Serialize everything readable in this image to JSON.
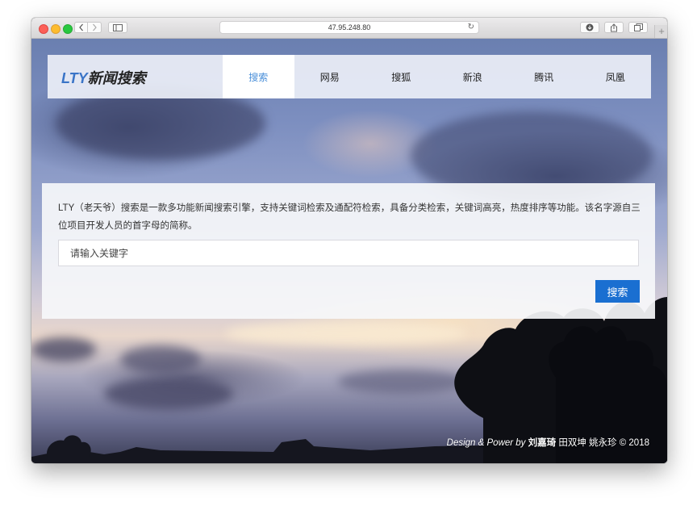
{
  "browser": {
    "url": "47.95.248.80",
    "icons": {
      "back": "chevron-left-icon",
      "forward": "chevron-right-icon",
      "sidebar": "sidebar-icon",
      "reload": "reload-icon",
      "download": "download-icon",
      "share": "share-icon",
      "tabs": "tabs-icon",
      "new_tab": "plus-icon"
    }
  },
  "header": {
    "logo_en": "LTY",
    "logo_cn": "新闻搜索",
    "nav": [
      {
        "label": "搜索",
        "active": true
      },
      {
        "label": "网易",
        "active": false
      },
      {
        "label": "搜狐",
        "active": false
      },
      {
        "label": "新浪",
        "active": false
      },
      {
        "label": "腾讯",
        "active": false
      },
      {
        "label": "凤凰",
        "active": false
      }
    ]
  },
  "search": {
    "description": "LTY（老天爷）搜索是一款多功能新闻搜索引擎，支持关键词检索及通配符检索，具备分类检索，关键词高亮，热度排序等功能。该名字源自三位项目开发人员的首字母的简称。",
    "placeholder": "请输入关键字",
    "value": "",
    "button_label": "搜索"
  },
  "footer": {
    "design_text": "Design & Power by",
    "author_1": "刘嘉琦",
    "others": "田双坤 姚永珍 © 2018"
  },
  "colors": {
    "accent": "#1a6fd1",
    "nav_active_text": "#4a8fd9",
    "logo_en": "#3a74c7"
  }
}
